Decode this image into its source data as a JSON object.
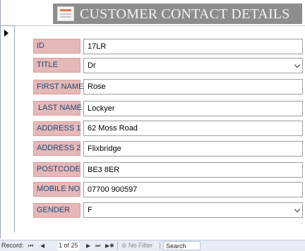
{
  "form": {
    "title": "CUSTOMER CONTACT DETAILS",
    "icon": "form-icon"
  },
  "fields": [
    {
      "label": "ID",
      "value": "17LR",
      "type": "text"
    },
    {
      "label": "TITLE",
      "value": "Dr",
      "type": "combo"
    },
    {
      "label": "FIRST NAME",
      "value": "Rose",
      "type": "text"
    },
    {
      "label": "LAST NAME",
      "value": "Lockyer",
      "type": "text"
    },
    {
      "label": "ADDRESS 1",
      "value": "62 Moss Road",
      "type": "text"
    },
    {
      "label": "ADDRESS 2",
      "value": "Flixbridge",
      "type": "text"
    },
    {
      "label": "POSTCODE",
      "value": "BE3 8ER",
      "type": "text"
    },
    {
      "label": "MOBILE NO",
      "value": "07700 900597",
      "type": "text"
    },
    {
      "label": "GENDER",
      "value": "F",
      "type": "combo"
    }
  ],
  "navigation": {
    "label": "Record:",
    "first": "⏮",
    "prev": "◀",
    "counter": "1 of 25",
    "next": "▶",
    "last": "⏭",
    "new_record": "▶✱",
    "filter": "No Filter",
    "search": "Search"
  },
  "colors": {
    "header_band": "#8d8d8d",
    "label_fill": "#e6b8b7",
    "label_text": "#1f497d"
  }
}
